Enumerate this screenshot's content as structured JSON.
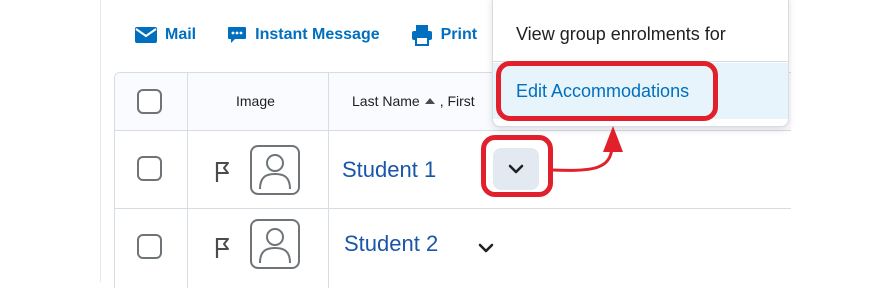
{
  "toolbar": {
    "mail_label": "Mail",
    "instant_message_label": "Instant Message",
    "print_label": "Print"
  },
  "table": {
    "col_image": "Image",
    "col_last_name": "Last Name",
    "col_first_partial": ", First",
    "rows": [
      {
        "name": "Student 1"
      },
      {
        "name": "Student 2"
      }
    ]
  },
  "menu": {
    "items": [
      {
        "label": "View group enrolments for"
      },
      {
        "label": "Edit Accommodations"
      }
    ]
  },
  "colors": {
    "accent": "#006fbf",
    "link": "#1a55a8",
    "annotation": "#e2202c",
    "highlight_bg": "#e8f4fc"
  }
}
